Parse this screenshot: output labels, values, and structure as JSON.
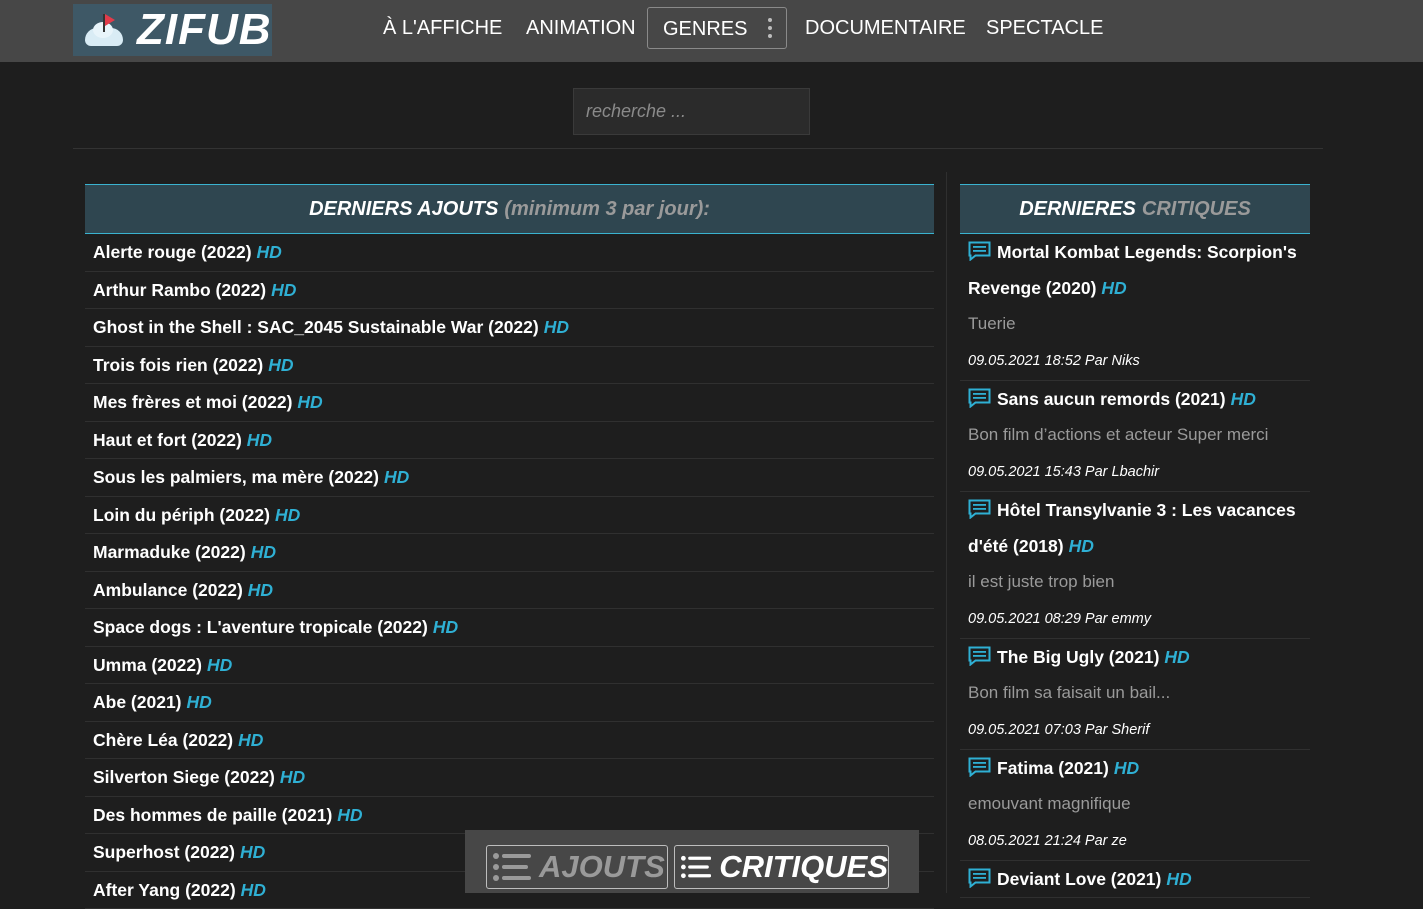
{
  "header": {
    "logo_text": "ZIFUB",
    "nav": [
      "À L'AFFICHE",
      "ANIMATION",
      "GENRES",
      "DOCUMENTAIRE",
      "SPECTACLE"
    ]
  },
  "search": {
    "placeholder": "recherche ..."
  },
  "additions": {
    "title": "DERNIERS AJOUTS",
    "subtitle": "(minimum 3 par jour):",
    "hd_label": "HD",
    "items": [
      "Alerte rouge (2022)",
      "Arthur Rambo (2022)",
      "Ghost in the Shell : SAC_2045 Sustainable War (2022)",
      "Trois fois rien (2022)",
      "Mes frères et moi (2022)",
      "Haut et fort (2022)",
      "Sous les palmiers, ma mère (2022)",
      "Loin du périph (2022)",
      "Marmaduke (2022)",
      "Ambulance (2022)",
      "Space dogs : L'aventure tropicale (2022)",
      "Umma (2022)",
      "Abe (2021)",
      "Chère Léa (2022)",
      "Silverton Siege (2022)",
      "Des hommes de paille (2021)",
      "Superhost (2022)",
      "After Yang (2022)"
    ]
  },
  "reviews": {
    "title_main": "DERNIERES",
    "title_dim": "CRITIQUES",
    "items": [
      {
        "title": "Mortal Kombat Legends: Scorpion's Revenge (2020)",
        "text": "Tuerie",
        "meta": "09.05.2021 18:52 Par Niks"
      },
      {
        "title": "Sans aucun remords (2021)",
        "text": "Bon film d’actions et acteur Super merci",
        "meta": "09.05.2021 15:43 Par Lbachir"
      },
      {
        "title": "Hôtel Transylvanie 3 : Les vacances d'été (2018)",
        "text": "il est juste trop bien",
        "meta": "09.05.2021 08:29 Par emmy"
      },
      {
        "title": "The Big Ugly (2021)",
        "text": "Bon film sa faisait un bail...",
        "meta": "09.05.2021 07:03 Par Sherif"
      },
      {
        "title": "Fatima (2021)",
        "text": "emouvant magnifique",
        "meta": "08.05.2021 21:24 Par ze"
      },
      {
        "title": "Deviant Love (2021)",
        "text": "",
        "meta": ""
      }
    ]
  },
  "floatbar": {
    "ajouts_label": "AJOUTS",
    "critiques_label": "CRITIQUES"
  }
}
